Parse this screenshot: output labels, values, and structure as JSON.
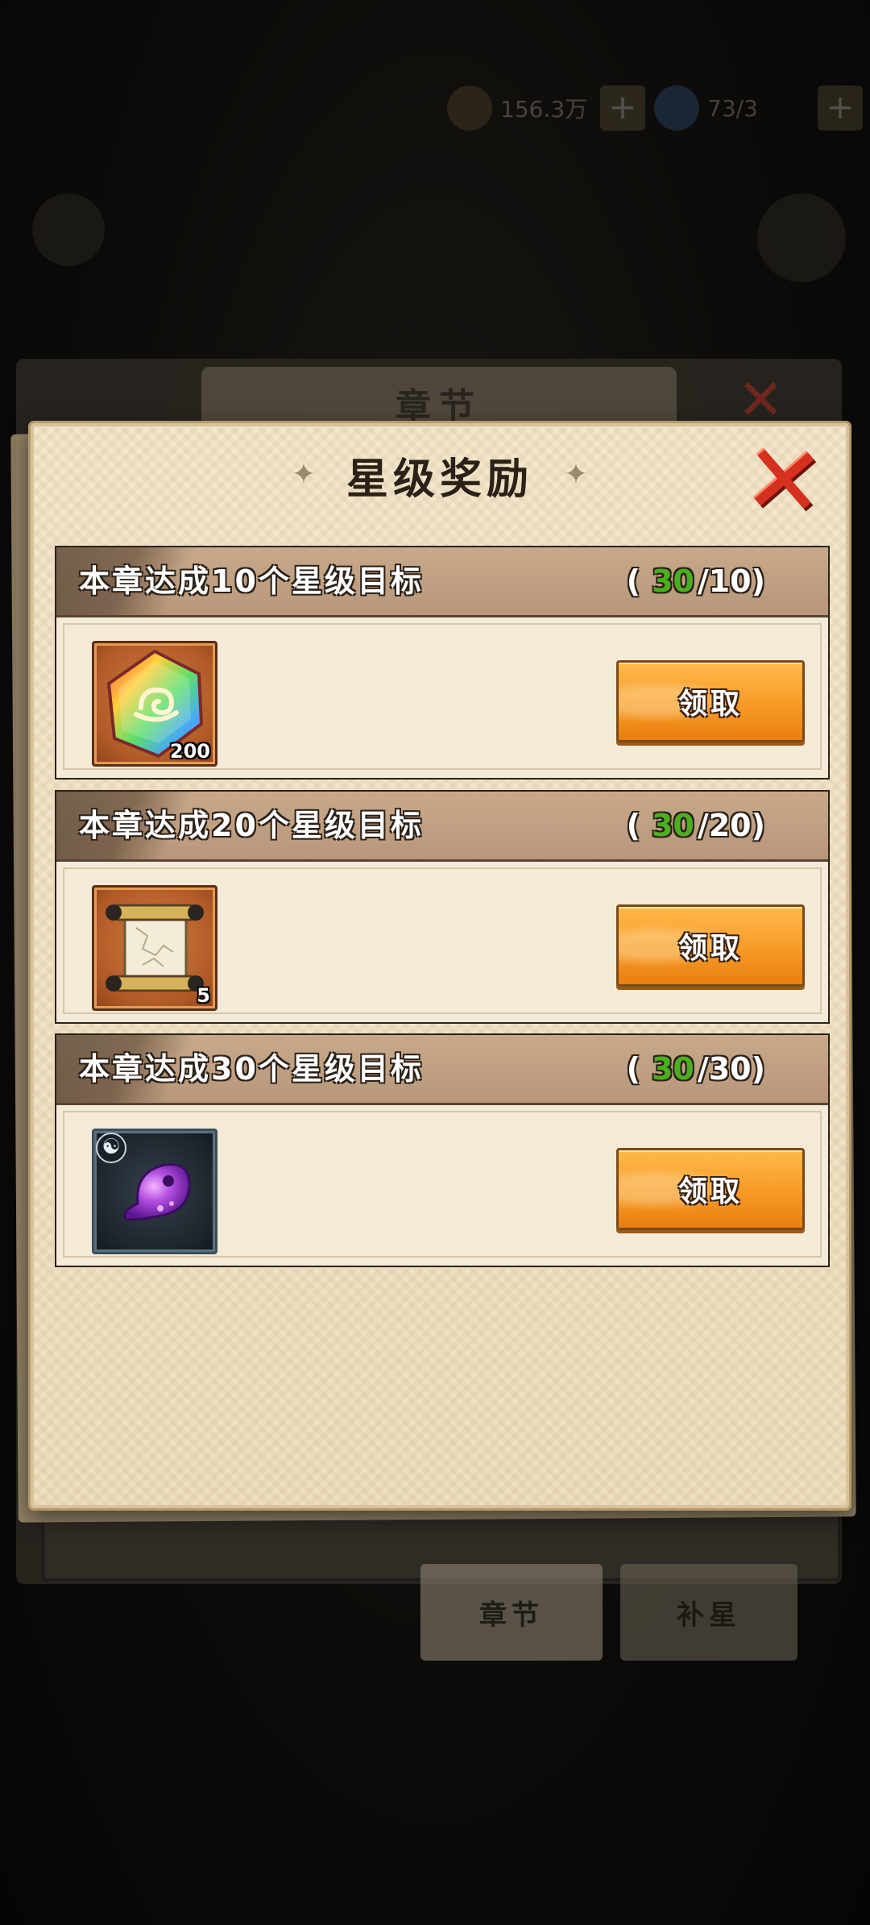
{
  "topbar": {
    "coins": "156.3万",
    "stamina": "73/3",
    "plus_symbol": "+"
  },
  "background": {
    "panel_title": "章节",
    "tabs": [
      {
        "label": "章节"
      },
      {
        "label": "补星"
      }
    ]
  },
  "modal": {
    "title": "星级奖励",
    "title_deco": "✦",
    "close_symbol": "✕",
    "sections": [
      {
        "title": "本章达成10个星级目标",
        "open_paren": "(",
        "current": "30",
        "target": "/10",
        "close_paren": ")",
        "item": {
          "icon": "rainbow-gem-icon",
          "count": "200"
        },
        "button_label": "领取"
      },
      {
        "title": "本章达成20个星级目标",
        "open_paren": "(",
        "current": "30",
        "target": "/20",
        "close_paren": ")",
        "item": {
          "icon": "scroll-icon",
          "count": "5"
        },
        "button_label": "领取"
      },
      {
        "title": "本章达成30个星级目标",
        "open_paren": "(",
        "current": "30",
        "target": "/30",
        "close_paren": ")",
        "item": {
          "icon": "purple-spirit-icon",
          "badge_icon": "yin-yang-icon",
          "badge_glyph": "☯"
        },
        "button_label": "领取"
      }
    ]
  },
  "colors": {
    "accent_orange": "#f79a27",
    "progress_green": "#4caf20",
    "close_red": "#d6301f",
    "header_bar": "#b8977a"
  }
}
